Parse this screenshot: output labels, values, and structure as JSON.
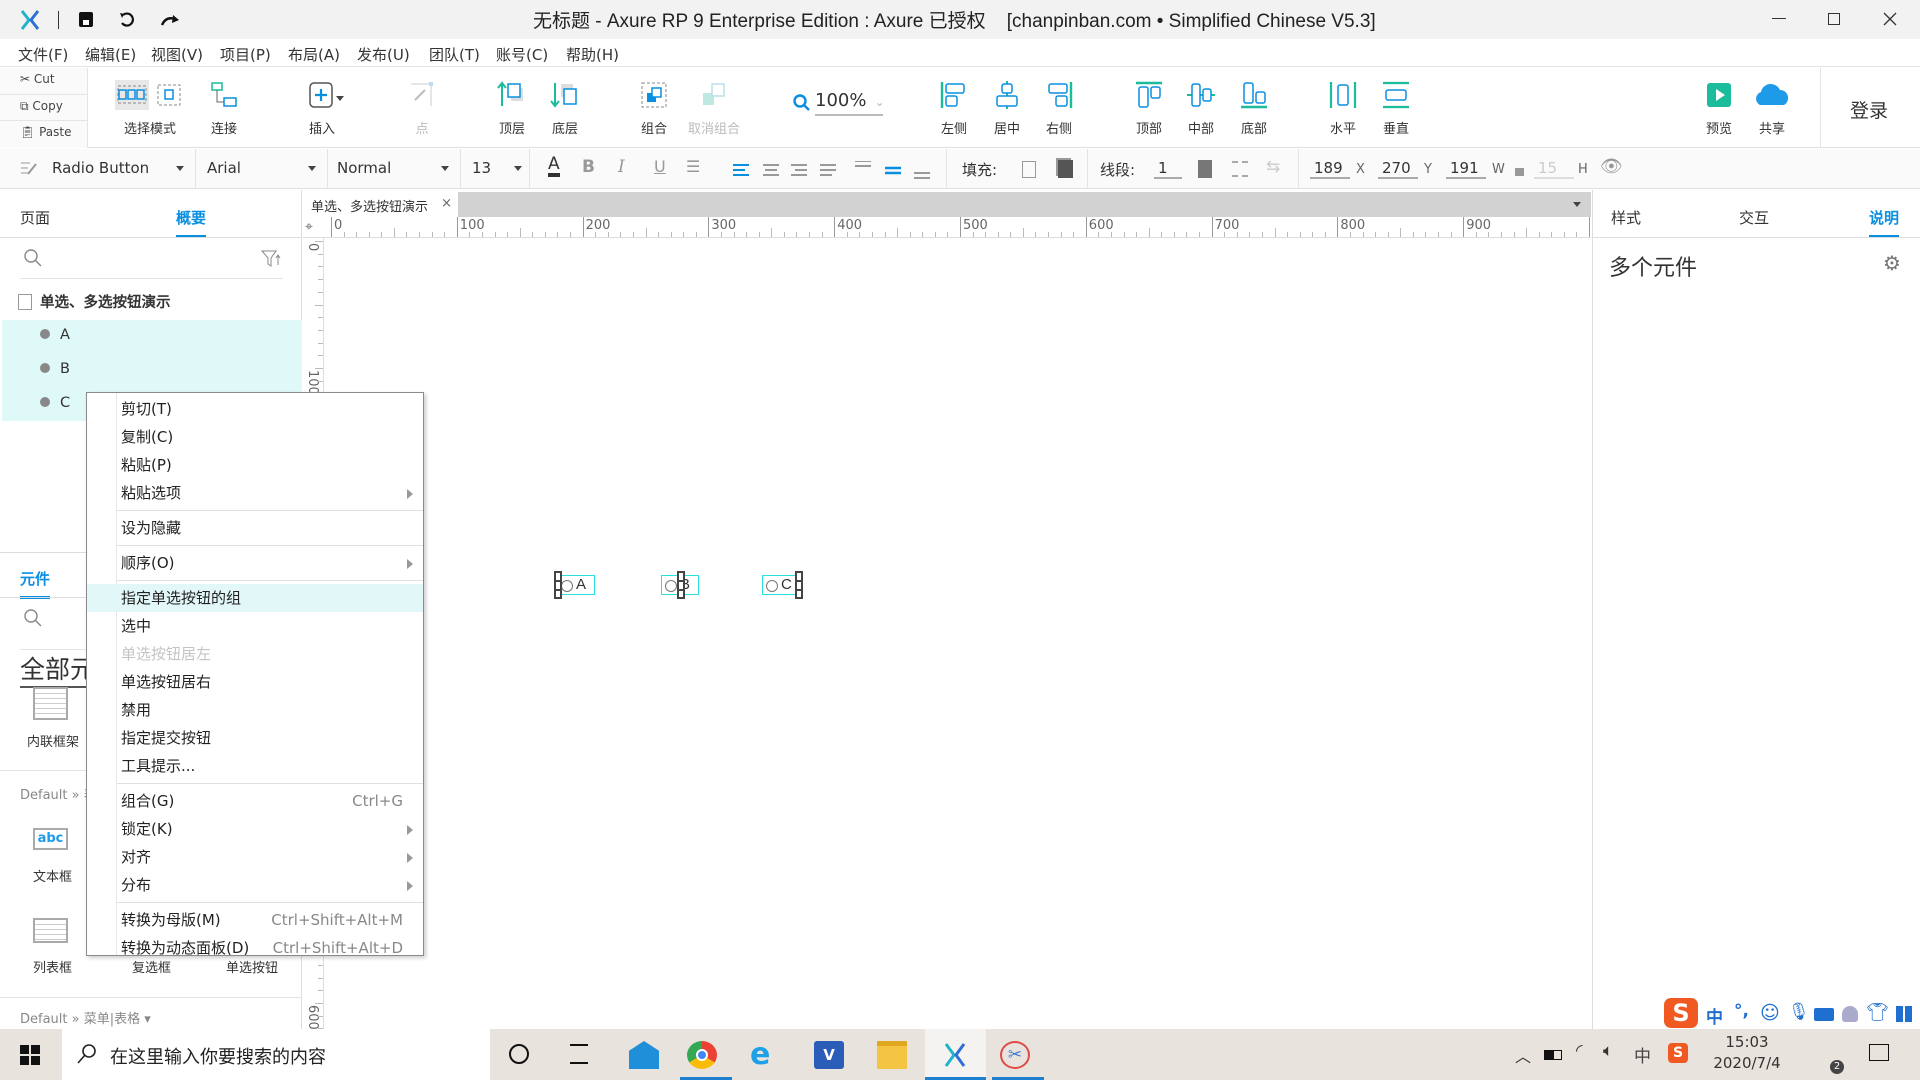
{
  "titlebar": {
    "title": "无标题 - Axure RP 9 Enterprise Edition : Axure 已授权    [chanpinban.com • Simplified Chinese V5.3]"
  },
  "menubar": [
    "文件(F)",
    "编辑(E)",
    "视图(V)",
    "项目(P)",
    "布局(A)",
    "发布(U)",
    "团队(T)",
    "账号(C)",
    "帮助(H)"
  ],
  "clipboard": {
    "cut": "Cut",
    "copy": "Copy",
    "paste": "Paste"
  },
  "toolbar": {
    "select_mode": "选择模式",
    "connect": "连接",
    "insert": "插入",
    "point": "点",
    "bring_front": "顶层",
    "send_back": "底层",
    "group": "组合",
    "ungroup": "取消组合",
    "zoom": "100%",
    "align_left": "左侧",
    "align_center": "居中",
    "align_right": "右侧",
    "align_top": "顶部",
    "align_middle": "中部",
    "align_bottom": "底部",
    "dist_h": "水平",
    "dist_v": "垂直",
    "preview": "预览",
    "share": "共享",
    "login": "登录"
  },
  "stylebar": {
    "style": "Radio Button",
    "font": "Arial",
    "weight": "Normal",
    "size": "13",
    "fill_label": "填充:",
    "line_label": "线段:",
    "line_width": "1",
    "x": "189",
    "x_label": "X",
    "y": "270",
    "y_label": "Y",
    "w": "191",
    "w_label": "W",
    "h": "15",
    "h_label": "H"
  },
  "left": {
    "tabs": [
      "页面",
      "概要"
    ],
    "outline": {
      "page": "单选、多选按钮演示",
      "items": [
        "A",
        "B",
        "C"
      ]
    },
    "widgets": {
      "tab": "元件",
      "heading": "全部元",
      "inline_frame": "内联框架",
      "lib1": "Default » 表",
      "text_field": "文本框",
      "list_box": "列表框",
      "checkbox": "复选框",
      "radio": "单选按钮",
      "lib2": "Default » 菜单|表格 ▾"
    }
  },
  "canvas": {
    "tab": "单选、多选按钮演示",
    "hruler": [
      "0",
      "100",
      "200",
      "300",
      "400",
      "500",
      "600",
      "700",
      "800",
      "900",
      "10"
    ],
    "vruler": [
      "0",
      "100",
      "600"
    ],
    "radios": [
      "A",
      "B",
      "C"
    ]
  },
  "right": {
    "tabs": [
      "样式",
      "交互",
      "说明"
    ],
    "active_tab": "说明",
    "heading": "多个元件"
  },
  "context_menu": [
    {
      "label": "剪切(T)"
    },
    {
      "label": "复制(C)"
    },
    {
      "label": "粘贴(P)"
    },
    {
      "label": "粘贴选项",
      "submenu": true
    },
    {
      "sep": true
    },
    {
      "label": "设为隐藏"
    },
    {
      "sep": true
    },
    {
      "label": "顺序(O)",
      "submenu": true
    },
    {
      "sep": true
    },
    {
      "label": "指定单选按钮的组",
      "highlighted": true
    },
    {
      "label": "选中"
    },
    {
      "label": "单选按钮居左",
      "disabled": true
    },
    {
      "label": "单选按钮居右"
    },
    {
      "label": "禁用"
    },
    {
      "label": "指定提交按钮"
    },
    {
      "label": "工具提示..."
    },
    {
      "sep": true
    },
    {
      "label": "组合(G)",
      "shortcut": "Ctrl+G"
    },
    {
      "label": "锁定(K)",
      "submenu": true
    },
    {
      "label": "对齐",
      "submenu": true
    },
    {
      "label": "分布",
      "submenu": true
    },
    {
      "sep": true
    },
    {
      "label": "转换为母版(M)",
      "shortcut": "Ctrl+Shift+Alt+M"
    },
    {
      "label": "转换为动态面板(D)",
      "shortcut": "Ctrl+Shift+Alt+D"
    }
  ],
  "taskbar": {
    "search_placeholder": "在这里输入你要搜索的内容",
    "time": "15:03",
    "date": "2020/7/4",
    "ime": "中",
    "notif_count": "2"
  },
  "ime_bar": {
    "mode": "中",
    "punct": "°,"
  },
  "colors": {
    "accent": "#0a8fe0",
    "teal": "#1abc9c",
    "highlight": "#e2f7f8",
    "selection": "#00e0e0"
  }
}
